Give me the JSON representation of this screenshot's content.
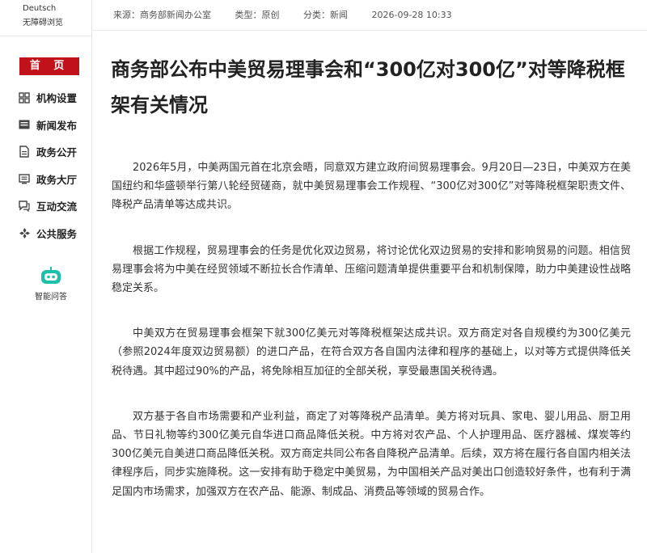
{
  "sidebar": {
    "lang_links": [
      "Deutsch",
      "无障碍浏览"
    ],
    "home_label": "首 页",
    "nav_items": [
      {
        "label": "机构设置",
        "icon": "org-chart-icon"
      },
      {
        "label": "新闻发布",
        "icon": "news-icon"
      },
      {
        "label": "政务公开",
        "icon": "document-icon"
      },
      {
        "label": "政务大厅",
        "icon": "service-hall-icon"
      },
      {
        "label": "互动交流",
        "icon": "chat-icon"
      },
      {
        "label": "公共服务",
        "icon": "public-service-icon"
      }
    ],
    "qa_label": "智能问答",
    "qa_icon": "robot-icon"
  },
  "meta": {
    "source": "来源：商务部新闻办公室",
    "type": "类型：原创",
    "category": "分类：新闻",
    "datetime": "2026-09-28 10:33"
  },
  "article": {
    "title": "商务部公布中美贸易理事会和“300亿对300亿”对等降税框架有关情况",
    "paragraphs": [
      "2026年5月，中美两国元首在北京会晤，同意双方建立政府间贸易理事会。9月20日—23日，中美双方在美国纽约和华盛顿举行第八轮经贸磋商，就中美贸易理事会工作规程、“300亿对300亿”对等降税框架职责文件、降税产品清单等达成共识。",
      "根据工作规程，贸易理事会的任务是优化双边贸易，将讨论优化双边贸易的安排和影响贸易的问题。相信贸易理事会将为中美在经贸领域不断拉长合作清单、压缩问题清单提供重要平台和机制保障，助力中美建设性战略稳定关系。",
      "中美双方在贸易理事会框架下就300亿美元对等降税框架达成共识。双方商定对各自规模约为300亿美元（参照2024年度双边贸易额）的进口产品，在符合双方各自国内法律和程序的基础上，以对等方式提供降低关税待遇。其中超过90%的产品，将免除相互加征的全部关税，享受最惠国关税待遇。",
      "双方基于各自市场需要和产业利益，商定了对等降税产品清单。美方将对玩具、家电、婴儿用品、厨卫用品、节日礼物等约300亿美元自华进口商品降低关税。中方将对农产品、个人护理用品、医疗器械、煤炭等约300亿美元自美进口商品降低关税。双方商定共同公布各自降税产品清单。后续，双方将在履行各自国内相关法律程序后，同步实施降税。这一安排有助于稳定中美贸易，为中国相关产品对美出口创造较好条件，也有利于满足国内市场需求，加强双方在农产品、能源、制成品、消费品等领域的贸易合作。"
    ]
  },
  "colors": {
    "accent": "#c1121c",
    "qa_icon": "#1dbfa8"
  }
}
